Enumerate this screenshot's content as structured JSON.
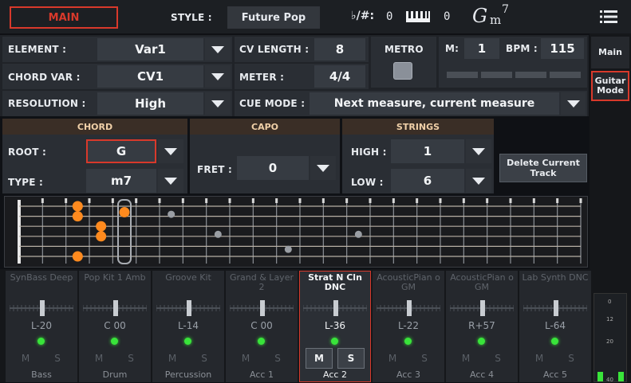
{
  "topbar": {
    "main_label": "MAIN",
    "style_label": "STYLE :",
    "style_value": "Future Pop",
    "key_label": "♭/#:",
    "key_value": "0",
    "transpose_value": "0",
    "chord_root": "G",
    "chord_sub": "m",
    "chord_sup": "7"
  },
  "params": {
    "element_label": "ELEMENT :",
    "element_value": "Var1",
    "chordvar_label": "CHORD VAR :",
    "chordvar_value": "CV1",
    "resolution_label": "RESOLUTION :",
    "resolution_value": "High",
    "cvlength_label": "CV LENGTH :",
    "cvlength_value": "8",
    "meter_label": "METER :",
    "meter_value": "4/4",
    "metro_label": "METRO",
    "m_label": "M:",
    "m_value": "1",
    "bpm_label": "BPM :",
    "bpm_value": "115",
    "cuemode_label": "CUE MODE :",
    "cuemode_value": "Next measure, current measure"
  },
  "side": {
    "main_label": "Main",
    "guitar_label": "Guitar Mode"
  },
  "chord": {
    "header": "CHORD",
    "root_label": "ROOT :",
    "root_value": "G",
    "type_label": "TYPE :",
    "type_value": "m7"
  },
  "capo": {
    "header": "CAPO",
    "fret_label": "FRET :",
    "fret_value": "0"
  },
  "strings": {
    "header": "STRINGS",
    "high_label": "HIGH :",
    "high_value": "1",
    "low_label": "LOW :",
    "low_value": "6"
  },
  "delete_label": "Delete Current Track",
  "fretboard": {
    "frets": 24,
    "strings": 6,
    "notes": [
      {
        "string": 1,
        "fret": 3
      },
      {
        "string": 2,
        "fret": 3
      },
      {
        "string": 3,
        "fret": 4
      },
      {
        "string": 4,
        "fret": 4
      },
      {
        "string": 6,
        "fret": 3
      },
      {
        "string": 1.6,
        "fret": 5
      }
    ]
  },
  "tracks": [
    {
      "name": "SynBass Deep",
      "value": "L-20",
      "label": "Bass",
      "active": false,
      "m": "M",
      "s": "S"
    },
    {
      "name": "Pop Kit 1 Amb",
      "value": "C 00",
      "label": "Drum",
      "active": false,
      "m": "M",
      "s": "S"
    },
    {
      "name": "Groove Kit",
      "value": "L-14",
      "label": "Percussion",
      "active": false,
      "m": "M",
      "s": "S"
    },
    {
      "name": "Grand & Layer 2",
      "value": "C 00",
      "label": "Acc 1",
      "active": false,
      "m": "M",
      "s": "S"
    },
    {
      "name": "Strat N Cln DNC",
      "value": "L-36",
      "label": "Acc 2",
      "active": true,
      "m": "M",
      "s": "S"
    },
    {
      "name": "AcousticPian o GM",
      "value": "L-22",
      "label": "Acc 3",
      "active": false,
      "m": "M",
      "s": "S"
    },
    {
      "name": "AcousticPian o GM",
      "value": "R+57",
      "label": "Acc 4",
      "active": false,
      "m": "M",
      "s": "S"
    },
    {
      "name": "Lab Synth DNC",
      "value": "L-64",
      "label": "Acc 5",
      "active": false,
      "m": "M",
      "s": "S"
    }
  ],
  "meter_scale": [
    "0",
    "12",
    "20",
    "40"
  ],
  "colors": {
    "accent_red": "#d8392b",
    "note_orange": "#ff8a1e",
    "led_green": "#39e43a",
    "header_bg": "#3a2e26"
  }
}
